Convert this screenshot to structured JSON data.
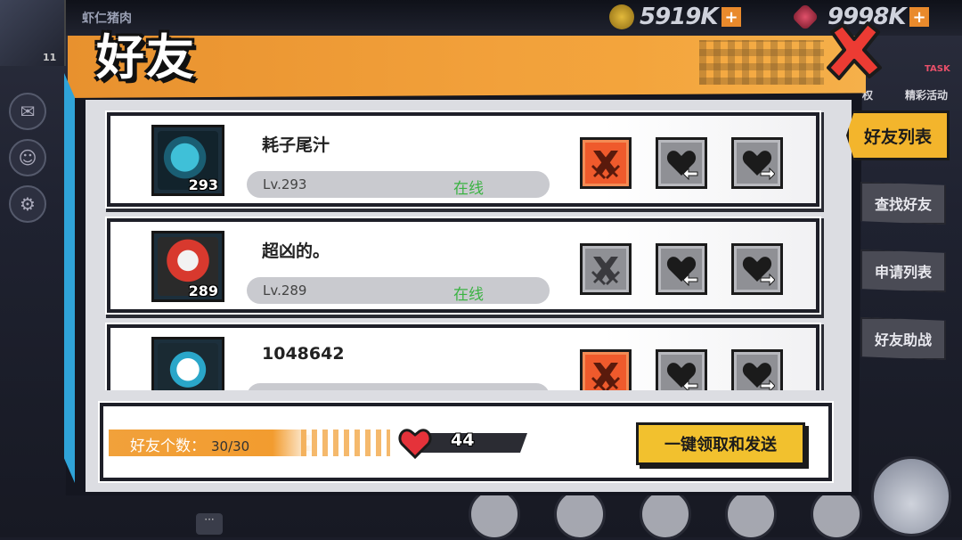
{
  "background": {
    "player_title": "虾仁猪肉",
    "player_level": "11",
    "coins": "5919K",
    "gems": "9998K",
    "right_labels": [
      "权",
      "精彩活动",
      "TASK"
    ]
  },
  "panel": {
    "title": "好友"
  },
  "friends": [
    {
      "name": "耗子尾汁",
      "level_text": "Lv.293",
      "avatar_level": "293",
      "status": "在线",
      "fight_active": true
    },
    {
      "name": "超凶的。",
      "level_text": "Lv.289",
      "avatar_level": "289",
      "status": "在线",
      "fight_active": false
    },
    {
      "name": "1048642",
      "level_text": "",
      "avatar_level": "",
      "status": "",
      "fight_active": true
    }
  ],
  "footer": {
    "count_label": "好友个数：",
    "count_value": "30/30",
    "hearts": "44",
    "claim_label": "一键领取和发送"
  },
  "tabs": [
    {
      "label": "好友列表",
      "active": true
    },
    {
      "label": "查找好友",
      "active": false
    },
    {
      "label": "申请列表",
      "active": false
    },
    {
      "label": "好友助战",
      "active": false
    }
  ],
  "colors": {
    "accent_orange": "#f2a13b",
    "fight_on": "#ef5a2c",
    "online_green": "#3bb343",
    "button_yellow": "#f2c12e"
  }
}
